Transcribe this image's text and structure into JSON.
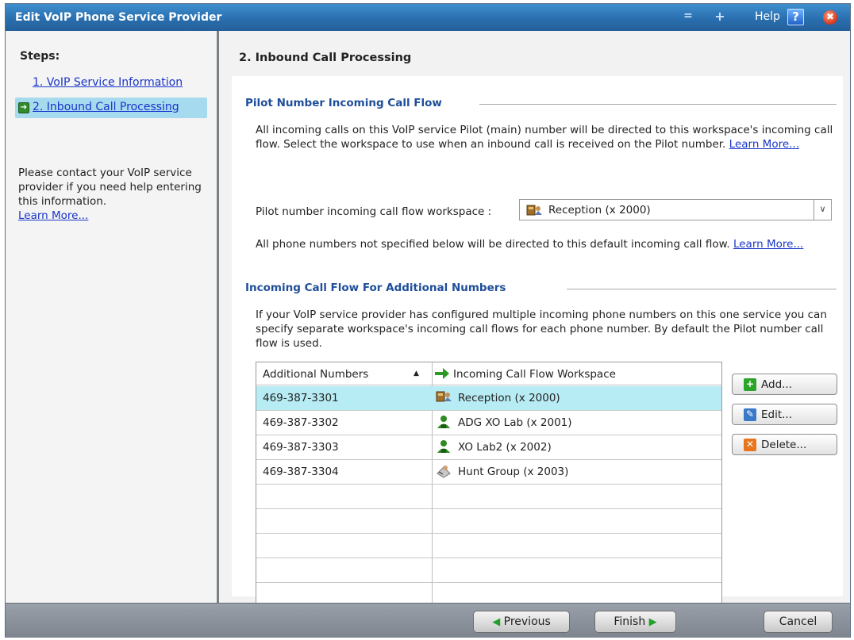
{
  "window": {
    "title": "Edit VoIP Phone Service Provider",
    "minimize_glyph": "=",
    "maximize_glyph": "+",
    "help_label": "Help",
    "help_icon": "?",
    "close_icon": "✖"
  },
  "left": {
    "steps_title": "Steps:",
    "step1": "1. VoIP Service Information",
    "step2": "2. Inbound Call Processing",
    "help_text": "Please contact your VoIP service provider if you need help entering this information.",
    "learn_more": "Learn More..."
  },
  "main": {
    "title": "2. Inbound Call Processing",
    "pilot_section": {
      "header": "Pilot Number Incoming Call Flow",
      "para_text": "All incoming calls on this VoIP service Pilot (main) number will be directed to this workspace's incoming call flow.  Select the workspace to use when an inbound call is received on the Pilot number.",
      "learn_more": "Learn More...",
      "workspace_label": "Pilot number incoming call flow workspace :",
      "workspace_value": "Reception (x 2000)",
      "default_text": "All phone numbers not specified below will be directed to this default incoming call flow.",
      "default_learn_more": "Learn More..."
    },
    "additional_section": {
      "header": "Incoming Call Flow For Additional Numbers",
      "para_text": "If your VoIP service provider has configured multiple incoming phone numbers on this one service you can specify separate workspace's incoming call flows for each phone number. By default the Pilot number call flow is used."
    },
    "grid": {
      "col1": "Additional Numbers",
      "sort_indicator": "▲",
      "col2": "Incoming Call Flow Workspace",
      "rows": [
        {
          "number": "469-387-3301",
          "workspace": "Reception (x 2000)",
          "icon": "reception-icon",
          "selected": true
        },
        {
          "number": "469-387-3302",
          "workspace": "ADG XO Lab (x 2001)",
          "icon": "user-icon",
          "selected": false
        },
        {
          "number": "469-387-3303",
          "workspace": "XO Lab2 (x 2002)",
          "icon": "user-icon",
          "selected": false
        },
        {
          "number": "469-387-3304",
          "workspace": "Hunt Group (x 2003)",
          "icon": "hunt-group-icon",
          "selected": false
        }
      ]
    },
    "buttons": {
      "add": "Add...",
      "edit": "Edit...",
      "delete": "Delete..."
    }
  },
  "footer": {
    "previous": "Previous",
    "finish": "Finish",
    "cancel": "Cancel"
  },
  "colors": {
    "titlebar": "#2a6faf",
    "selected_row": "#b8ecf4",
    "section_header": "#1f4e9a",
    "link": "#1a35c8"
  }
}
